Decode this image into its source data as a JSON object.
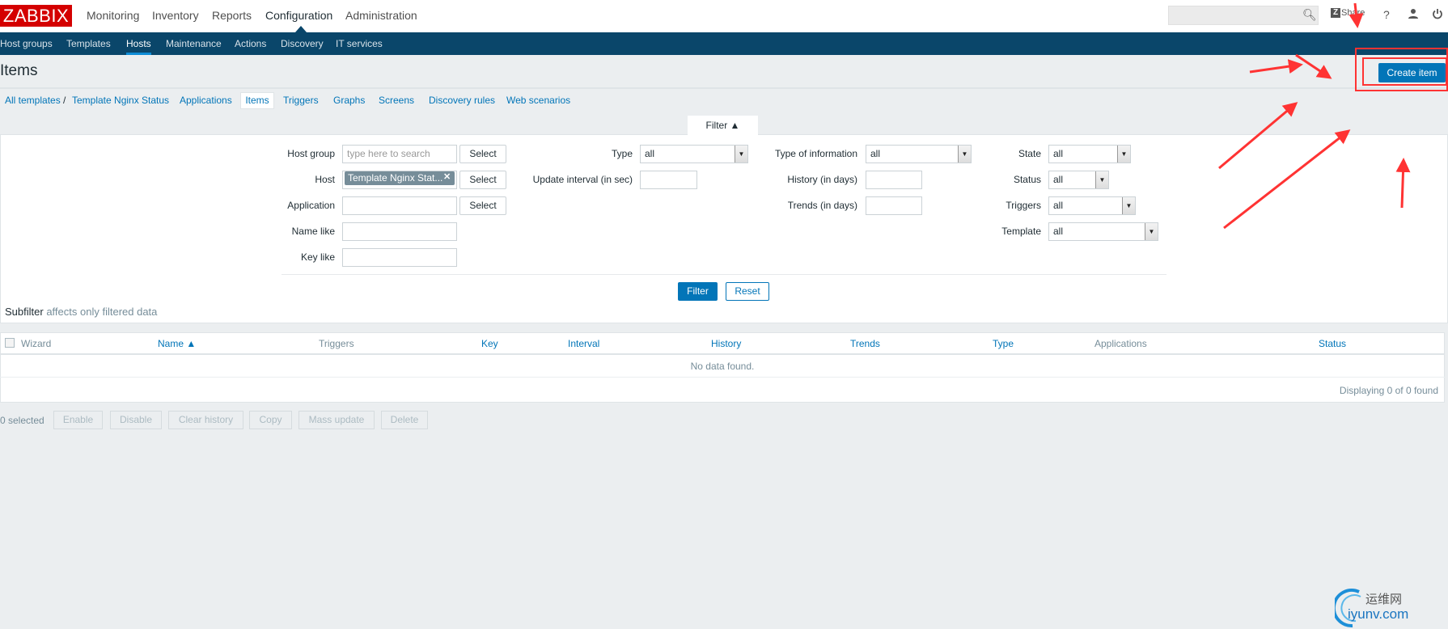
{
  "header": {
    "logo": "ZABBIX",
    "menu": [
      "Monitoring",
      "Inventory",
      "Reports",
      "Configuration",
      "Administration"
    ],
    "active_menu": "Configuration",
    "search_placeholder": "",
    "share_label": "Share",
    "help_label": "?",
    "icons": [
      "search-icon",
      "share-icon",
      "help-icon",
      "user-icon",
      "power-icon"
    ]
  },
  "subnav": {
    "items": [
      "Host groups",
      "Templates",
      "Hosts",
      "Maintenance",
      "Actions",
      "Discovery",
      "IT services"
    ],
    "active": "Hosts"
  },
  "page": {
    "title": "Items",
    "create_button": "Create item"
  },
  "tabs": {
    "breadcrumb_root": "All templates",
    "separator": "/",
    "template": "Template Nginx Status",
    "items": [
      "Applications",
      "Items",
      "Triggers",
      "Graphs",
      "Screens",
      "Discovery rules",
      "Web scenarios"
    ],
    "active": "Items"
  },
  "filter": {
    "tab_label": "Filter ▲",
    "host_group_label": "Host group",
    "host_group_placeholder": "type here to search",
    "host_label": "Host",
    "host_value": "Template Nginx Stat...",
    "application_label": "Application",
    "name_like_label": "Name like",
    "key_like_label": "Key like",
    "select_label": "Select",
    "type_label": "Type",
    "type_value": "all",
    "interval_label": "Update interval (in sec)",
    "type_info_label": "Type of information",
    "type_info_value": "all",
    "history_label": "History (in days)",
    "trends_label": "Trends (in days)",
    "state_label": "State",
    "state_value": "all",
    "status_label": "Status",
    "status_value": "all",
    "triggers_label": "Triggers",
    "triggers_value": "all",
    "template_label": "Template",
    "template_value": "all",
    "filter_button": "Filter",
    "reset_button": "Reset",
    "subfilter_title": "Subfilter",
    "subfilter_note": "affects only filtered data"
  },
  "table": {
    "columns": [
      "Wizard",
      "Name ▲",
      "Triggers",
      "Key",
      "Interval",
      "History",
      "Trends",
      "Type",
      "Applications",
      "Status"
    ],
    "empty": "No data found.",
    "footer": "Displaying 0 of 0 found"
  },
  "actions": {
    "selected": "0 selected",
    "buttons": [
      "Enable",
      "Disable",
      "Clear history",
      "Copy",
      "Mass update",
      "Delete"
    ]
  },
  "watermark": {
    "cn": "运维网",
    "domain": "iyunv.com"
  },
  "colors": {
    "brand_red": "#d40000",
    "nav": "#0a466a",
    "link": "#0275b8",
    "annotation": "#ff3333"
  }
}
